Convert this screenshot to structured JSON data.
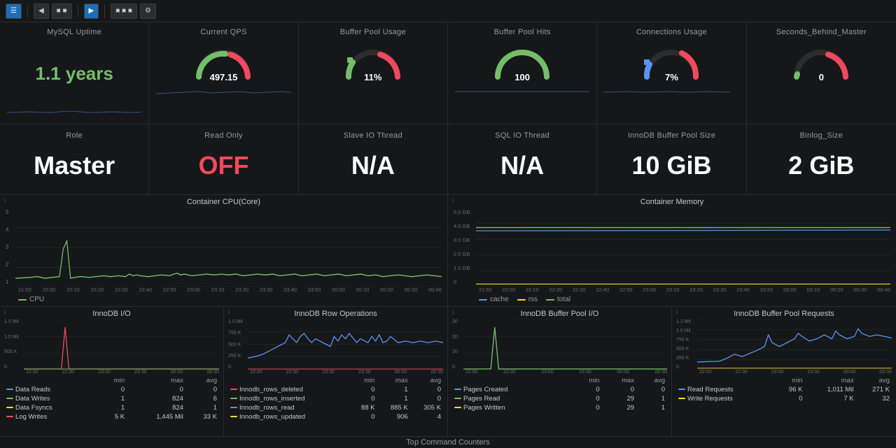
{
  "nav": {
    "buttons": [
      "☰",
      "⬅",
      "■ ■",
      "▶",
      "■  ■  ■",
      "⚙"
    ]
  },
  "metrics_top": [
    {
      "title": "MySQL Uptime",
      "value": "1.1 years",
      "type": "text-green",
      "gauge": null
    },
    {
      "title": "Current QPS",
      "value": "497.15",
      "type": "gauge-green-red",
      "gauge": {
        "percent": 40,
        "color_arc": "#73bf69"
      }
    },
    {
      "title": "Buffer Pool Usage",
      "value": "11%",
      "type": "gauge-green-red",
      "gauge": {
        "percent": 11,
        "color_arc": "#73bf69"
      }
    },
    {
      "title": "Buffer Pool Hits",
      "value": "100",
      "type": "gauge-green",
      "gauge": {
        "percent": 100,
        "color_arc": "#73bf69"
      }
    },
    {
      "title": "Connections Usage",
      "value": "7%",
      "type": "gauge-blue-red",
      "gauge": {
        "percent": 7,
        "color_arc": "#5794f2"
      }
    },
    {
      "title": "Seconds_Behind_Master",
      "value": "0",
      "type": "gauge-green-red",
      "gauge": {
        "percent": 2,
        "color_arc": "#73bf69"
      }
    }
  ],
  "metrics_row2": [
    {
      "title": "Role",
      "value": "Master",
      "type": "white"
    },
    {
      "title": "Read Only",
      "value": "OFF",
      "type": "red"
    },
    {
      "title": "Slave IO Thread",
      "value": "N/A",
      "type": "white"
    },
    {
      "title": "SQL IO Thread",
      "value": "N/A",
      "type": "white"
    },
    {
      "title": "InnoDB Buffer Pool Size",
      "value": "10 GiB",
      "type": "white"
    },
    {
      "title": "Binlog_Size",
      "value": "2 GiB",
      "type": "white"
    }
  ],
  "chart_cpu": {
    "title": "Container CPU(Core)",
    "legend": [
      {
        "label": "CPU",
        "color": "#73bf69"
      }
    ],
    "y_labels": [
      "5",
      "4",
      "3",
      "2",
      "1"
    ],
    "x_labels": [
      "21:50",
      "22:00",
      "22:10",
      "22:20",
      "22:30",
      "22:40",
      "22:50",
      "23:00",
      "23:10",
      "23:20",
      "23:30",
      "23:40",
      "23:50",
      "00:00",
      "00:10",
      "00:20",
      "00:30",
      "00:40"
    ]
  },
  "chart_memory": {
    "title": "Container Memory",
    "legend": [
      {
        "label": "cache",
        "color": "#5794f2"
      },
      {
        "label": "rss",
        "color": "#fade2a"
      },
      {
        "label": "total",
        "color": "#73bf69"
      }
    ],
    "y_labels": [
      "5.0 GB",
      "4.0 GB",
      "3.0 GB",
      "2.0 GB",
      "1.0 GB",
      "0"
    ],
    "x_labels": [
      "21:50",
      "22:00",
      "22:10",
      "22:20",
      "22:30",
      "22:40",
      "22:50",
      "23:00",
      "23:10",
      "23:20",
      "23:30",
      "23:40",
      "23:50",
      "00:00",
      "00:10",
      "00:20",
      "00:30",
      "00:40"
    ]
  },
  "chart_innodb_io": {
    "title": "InnoDB I/O",
    "y_labels": [
      "1.5 Mil",
      "1.0 Mil",
      "500 K",
      "0"
    ],
    "x_labels": [
      "22:00",
      "22:30",
      "23:00",
      "23:30",
      "00:00",
      "00:30"
    ],
    "legend": [
      {
        "label": "Data Reads",
        "color": "#5794f2",
        "min": "0",
        "max": "0",
        "avg": "0"
      },
      {
        "label": "Data Writes",
        "color": "#73bf69",
        "min": "1",
        "max": "824",
        "avg": "6"
      },
      {
        "label": "Data Fsyncs",
        "color": "#fade2a",
        "min": "1",
        "max": "824",
        "avg": "1"
      },
      {
        "label": "Log Writes",
        "color": "#f2495c",
        "min": "5 K",
        "max": "1,445 Mil",
        "avg": "33 K"
      }
    ]
  },
  "chart_innodb_row": {
    "title": "InnoDB Row Operations",
    "y_labels": [
      "1.0 Mil",
      "750 K",
      "500 K",
      "250 K",
      "0"
    ],
    "x_labels": [
      "22:00",
      "22:30",
      "23:00",
      "23:30",
      "00:00",
      "00:30"
    ],
    "legend": [
      {
        "label": "Innodb_rows_deleted",
        "color": "#f2495c",
        "min": "0",
        "max": "1",
        "avg": "0"
      },
      {
        "label": "Innodb_rows_inserted",
        "color": "#73bf69",
        "min": "0",
        "max": "1",
        "avg": "0"
      },
      {
        "label": "Innodb_rows_read",
        "color": "#5794f2",
        "min": "88 K",
        "max": "885 K",
        "avg": "305 K"
      },
      {
        "label": "Innodb_rows_updated",
        "color": "#fade2a",
        "min": "0",
        "max": "906",
        "avg": "4"
      }
    ]
  },
  "chart_innodb_pool_io": {
    "title": "InnoDB Buffer Pool I/O",
    "y_labels": [
      "30",
      "20",
      "10",
      "0"
    ],
    "x_labels": [
      "22:00",
      "22:30",
      "23:00",
      "23:30",
      "00:00",
      "00:30"
    ],
    "legend": [
      {
        "label": "Pages Created",
        "color": "#5794f2",
        "min": "0",
        "max": "0",
        "avg": "0"
      },
      {
        "label": "Pages Read",
        "color": "#73bf69",
        "min": "0",
        "max": "29",
        "avg": "1"
      },
      {
        "label": "Pages Written",
        "color": "#fade2a",
        "min": "0",
        "max": "29",
        "avg": "1"
      }
    ]
  },
  "chart_innodb_pool_req": {
    "title": "InnoDB Buffer Pool Requests",
    "y_labels": [
      "1.3 Mil",
      "1.0 Mil",
      "750 K",
      "500 K",
      "250 K",
      "0"
    ],
    "x_labels": [
      "22:00",
      "22:30",
      "23:00",
      "23:30",
      "00:00",
      "00:30"
    ],
    "legend": [
      {
        "label": "Read Requests",
        "color": "#5794f2",
        "min": "96 K",
        "max": "1,011 Mil",
        "avg": "271 K"
      },
      {
        "label": "Write Requests",
        "color": "#fade2a",
        "min": "0",
        "max": "7 K",
        "avg": "32"
      }
    ]
  },
  "bottom_label": "Top Command Counters"
}
